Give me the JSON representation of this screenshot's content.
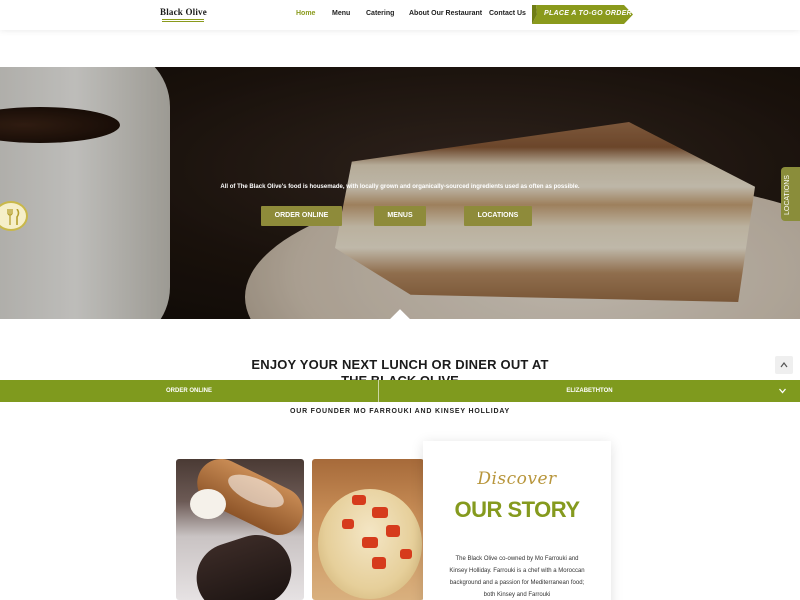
{
  "header": {
    "logo_text": "Black Olive",
    "nav": [
      {
        "label": "Home",
        "active": true
      },
      {
        "label": "Menu",
        "active": false
      },
      {
        "label": "Catering",
        "active": false
      },
      {
        "label": "About Our Restaurant",
        "active": false
      },
      {
        "label": "Contact Us",
        "active": false
      }
    ],
    "order_button": "PLACE A TO-GO ORDER"
  },
  "hero": {
    "tagline": "All of The Black Olive's food is housemade, with locally grown and organically-sourced ingredients used as often as possible.",
    "buttons": [
      "ORDER ONLINE",
      "MENUS",
      "LOCATIONS"
    ],
    "side_tab": "LOCATIONS"
  },
  "content": {
    "headline": "ENJOY YOUR NEXT LUNCH OR DINER OUT AT",
    "headline_cut": "THE BLACK OLIVE",
    "sticky_bar": {
      "left": "ORDER ONLINE",
      "right": "ELIZABETHTON"
    },
    "founder": "OUR FOUNDER MO FARROUKI AND KINSEY HOLLIDAY",
    "story": {
      "script": "Discover",
      "title": "OUR STORY",
      "text": "The Black Olive co-owned by Mo Farrouki and Kinsey Holliday. Farrouki is a chef with a Moroccan background and a passion for Mediterranean food; both Kinsey and Farrouki"
    }
  },
  "colors": {
    "accent_green": "#859a1e",
    "bar_green": "#7f9a1e",
    "hero_button": "#8e8b3a",
    "gold": "#b8963c"
  }
}
